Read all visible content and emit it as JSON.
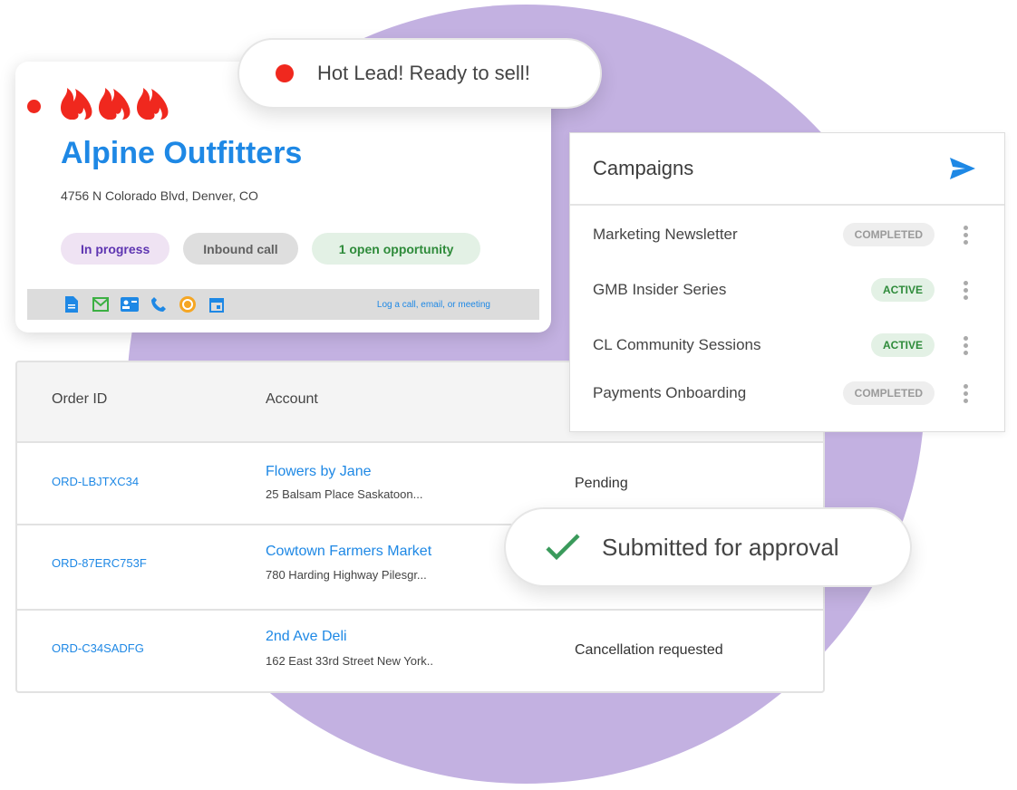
{
  "hot_lead": {
    "text": "Hot Lead! Ready to sell!",
    "dot_color": "#f0281e"
  },
  "lead_card": {
    "flame_icons": [
      "fire-icon",
      "fire-icon",
      "fire-icon"
    ],
    "company": "Alpine Outfitters",
    "address": "4756 N Colorado Blvd, Denver, CO",
    "chips": [
      {
        "label": "In progress",
        "bg": "#efe3f3",
        "color": "#5e35b1"
      },
      {
        "label": "Inbound call",
        "bg": "#dedede",
        "color": "#616161"
      },
      {
        "label": "1 open opportunity",
        "bg": "#e3f1e5",
        "color": "#2e8b3a"
      }
    ],
    "toolbar_icons": [
      "document-icon",
      "email-icon",
      "contact-card-icon",
      "phone-icon",
      "badge-icon",
      "calendar-icon"
    ],
    "log_link": "Log a call, email, or meeting"
  },
  "campaigns": {
    "title": "Campaigns",
    "items": [
      {
        "name": "Marketing Newsletter",
        "status": "COMPLETED"
      },
      {
        "name": "GMB Insider Series",
        "status": "ACTIVE"
      },
      {
        "name": "CL Community Sessions",
        "status": "ACTIVE"
      },
      {
        "name": "Payments Onboarding",
        "status": "COMPLETED"
      }
    ]
  },
  "orders": {
    "headers": [
      "Order ID",
      "Account"
    ],
    "rows": [
      {
        "id": "ORD-LBJTXC34",
        "account": "Flowers by Jane",
        "address": "25 Balsam Place Saskatoon...",
        "status": "Pending"
      },
      {
        "id": "ORD-87ERC753F",
        "account": "Cowtown Farmers Market",
        "address": "780 Harding Highway Pilesgr...",
        "status": ""
      },
      {
        "id": "ORD-C34SADFG",
        "account": "2nd Ave Deli",
        "address": "162 East 33rd Street New York..",
        "status": "Cancellation requested"
      }
    ]
  },
  "submitted": {
    "text": "Submitted for approval",
    "check_color": "#3a9a5b"
  },
  "colors": {
    "accent": "#1e88e5",
    "blob": "#c3b1e1"
  }
}
